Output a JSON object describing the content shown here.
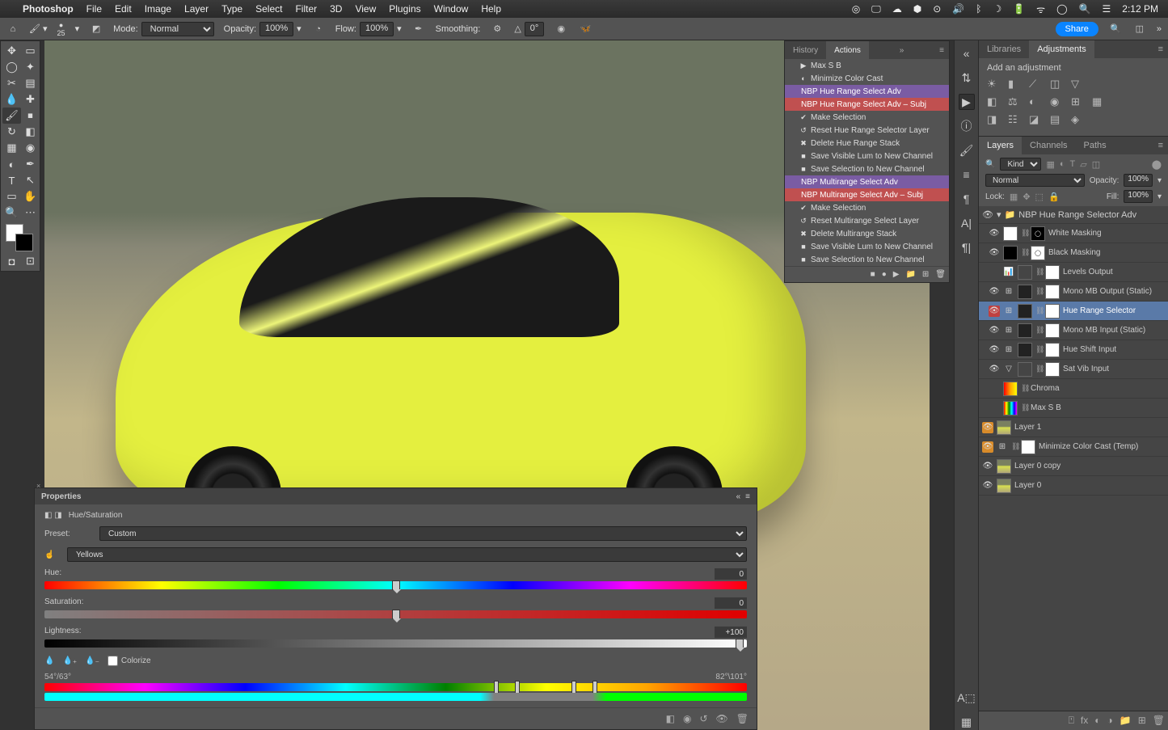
{
  "mac_menubar": {
    "app": "Photoshop",
    "menus": [
      "File",
      "Edit",
      "Image",
      "Layer",
      "Type",
      "Select",
      "Filter",
      "3D",
      "View",
      "Plugins",
      "Window",
      "Help"
    ],
    "battery": "",
    "time": "2:12 PM"
  },
  "options_bar": {
    "brush_size": "25",
    "mode_label": "Mode:",
    "mode": "Normal",
    "opacity_label": "Opacity:",
    "opacity": "100%",
    "flow_label": "Flow:",
    "flow": "100%",
    "smoothing_label": "Smoothing:",
    "angle": "0°",
    "share": "Share"
  },
  "actions_panel": {
    "tabs": [
      "History",
      "Actions"
    ],
    "active_tab": 1,
    "items": [
      {
        "label": "Max S B",
        "icon": "▶",
        "color": ""
      },
      {
        "label": "Minimize Color Cast",
        "icon": "◐",
        "color": ""
      },
      {
        "label": "NBP Hue Range Select Adv",
        "icon": "",
        "color": "purple"
      },
      {
        "label": "NBP Hue Range Select Adv – Subj",
        "icon": "",
        "color": "red"
      },
      {
        "label": "Make Selection",
        "icon": "✔",
        "color": ""
      },
      {
        "label": "Reset Hue Range Selector Layer",
        "icon": "↺",
        "color": ""
      },
      {
        "label": "Delete Hue Range Stack",
        "icon": "✖",
        "color": ""
      },
      {
        "label": "Save Visible Lum to New Channel",
        "icon": "■",
        "color": ""
      },
      {
        "label": "Save Selection to New Channel",
        "icon": "■",
        "color": ""
      },
      {
        "label": "NBP Multirange Select Adv",
        "icon": "",
        "color": "purple"
      },
      {
        "label": "NBP Multirange Select Adv – Subj",
        "icon": "",
        "color": "red"
      },
      {
        "label": "Make Selection",
        "icon": "✔",
        "color": ""
      },
      {
        "label": "Reset Multirange Select Layer",
        "icon": "↺",
        "color": ""
      },
      {
        "label": "Delete Multirange Stack",
        "icon": "✖",
        "color": ""
      },
      {
        "label": "Save Visible Lum to New Channel",
        "icon": "■",
        "color": ""
      },
      {
        "label": "Save Selection to New Channel",
        "icon": "■",
        "color": ""
      }
    ]
  },
  "adjustments": {
    "tabs": [
      "Libraries",
      "Adjustments"
    ],
    "active_tab": 1,
    "title": "Add an adjustment"
  },
  "layers_panel": {
    "tabs": [
      "Layers",
      "Channels",
      "Paths"
    ],
    "active_tab": 0,
    "kind_label": "Kind",
    "blend": "Normal",
    "opacity_label": "Opacity:",
    "opacity": "100%",
    "lock_label": "Lock:",
    "fill_label": "Fill:",
    "fill": "100%",
    "group": "NBP Hue Range Selector Adv",
    "layers": [
      {
        "name": "White Masking",
        "vis": "eye",
        "vis_color": "",
        "adj": "",
        "thumb1": "white",
        "thumb2": "black-mask"
      },
      {
        "name": "Black Masking",
        "vis": "eye",
        "vis_color": "",
        "adj": "",
        "thumb1": "black",
        "thumb2": "white-mask"
      },
      {
        "name": "Levels Output",
        "vis": "",
        "vis_color": "",
        "adj": "levels",
        "thumb1": "levels",
        "thumb2": "white"
      },
      {
        "name": "Mono MB Output (Static)",
        "vis": "eye",
        "vis_color": "",
        "adj": "grid",
        "thumb1": "grid",
        "thumb2": "white"
      },
      {
        "name": "Hue Range Selector",
        "vis": "eye",
        "vis_color": "red",
        "adj": "grid",
        "thumb1": "grid",
        "thumb2": "white",
        "selected": true
      },
      {
        "name": "Mono MB Input (Static)",
        "vis": "eye",
        "vis_color": "",
        "adj": "grid",
        "thumb1": "grid",
        "thumb2": "white"
      },
      {
        "name": "Hue Shift Input",
        "vis": "eye",
        "vis_color": "",
        "adj": "grid",
        "thumb1": "grid",
        "thumb2": "white"
      },
      {
        "name": "Sat Vib Input",
        "vis": "eye",
        "vis_color": "",
        "adj": "tri",
        "thumb1": "triangle",
        "thumb2": "white"
      },
      {
        "name": "Chroma",
        "vis": "",
        "vis_color": "",
        "adj": "",
        "thumb1": "grad",
        "thumb2": ""
      },
      {
        "name": "Max S B",
        "vis": "",
        "vis_color": "",
        "adj": "",
        "thumb1": "grad2",
        "thumb2": ""
      }
    ],
    "base_layers": [
      {
        "name": "Layer 1",
        "vis": "eye",
        "vis_color": "orange",
        "thumb": "img"
      },
      {
        "name": "Minimize Color Cast (Temp)",
        "vis": "eye",
        "vis_color": "orange",
        "adj": "grid",
        "thumb": "white"
      },
      {
        "name": "Layer 0 copy",
        "vis": "eye",
        "vis_color": "",
        "thumb": "img"
      },
      {
        "name": "Layer 0",
        "vis": "eye",
        "vis_color": "",
        "thumb": "img"
      }
    ]
  },
  "properties": {
    "title": "Properties",
    "adjustment_name": "Hue/Saturation",
    "preset_label": "Preset:",
    "preset": "Custom",
    "channel": "Yellows",
    "hue_label": "Hue:",
    "hue_value": "0",
    "sat_label": "Saturation:",
    "sat_value": "0",
    "light_label": "Lightness:",
    "light_value": "+100",
    "colorize_label": "Colorize",
    "range_left": "54°/63°",
    "range_right": "82°\\101°"
  }
}
